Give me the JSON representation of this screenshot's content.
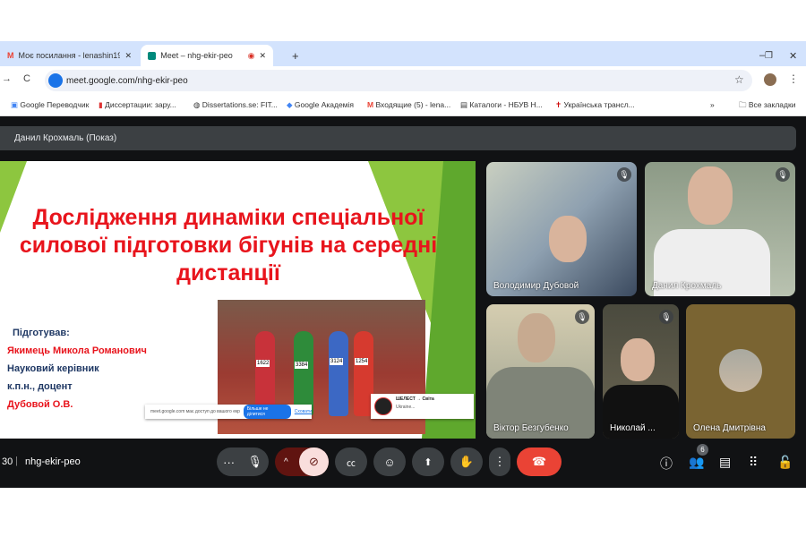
{
  "browser": {
    "tabs": [
      {
        "label": "Моє посилання - lenashin196",
        "icon": "gmail-icon"
      },
      {
        "label": "Meet – nhg-ekir-peo",
        "icon": "meet-icon",
        "active": true
      }
    ],
    "new_tab": "+",
    "url": "meet.google.com/nhg-ekir-peo",
    "bookmarks": [
      "Google Переводчик",
      "Диссертации: зару...",
      "Dissertations.se: FIT...",
      "Google Академія",
      "Входящие (5) - lena...",
      "Каталоги - НБУВ Н...",
      "Українська трансл..."
    ],
    "more_bookmarks": "»",
    "all_bookmarks": "Все закладки"
  },
  "meet": {
    "presenter_label": "Данил Крохмаль (Показ)",
    "slide": {
      "title": "Дослідження динаміки спеціальної силової підготовки бігунів на середні дистанції",
      "prepared_label": "Підготував:",
      "author": "Якимець Микола Романович",
      "supervisor_label": "Науковий керівник",
      "degree": "к.п.н., доцент",
      "supervisor": "Дубовой О.В.",
      "bibs": [
        "1622",
        "3384",
        "3124",
        "1254"
      ],
      "share_toast": {
        "text": "meet.google.com має доступ до вашого екрана",
        "stop": "Більше не ділитися",
        "hide": "Сховати"
      },
      "notification": {
        "title": "ШЕЛЕСТ → Світа",
        "body": "Ukraine..."
      }
    },
    "participants": [
      {
        "name": "Володимир Дубовой",
        "muted": true
      },
      {
        "name": "Данил Крохмаль",
        "muted": true
      },
      {
        "name": "Віктор Безгубенко",
        "muted": true
      },
      {
        "name": "Николай ...",
        "muted": true
      },
      {
        "name": "Олена Дмитрівна",
        "muted": false
      }
    ],
    "time": "30",
    "meeting_code": "nhg-ekir-peo",
    "participant_count": "6",
    "colors": {
      "end_call": "#ea4335",
      "camera_off": "#f9dedc",
      "accent": "#1a73e8"
    }
  }
}
